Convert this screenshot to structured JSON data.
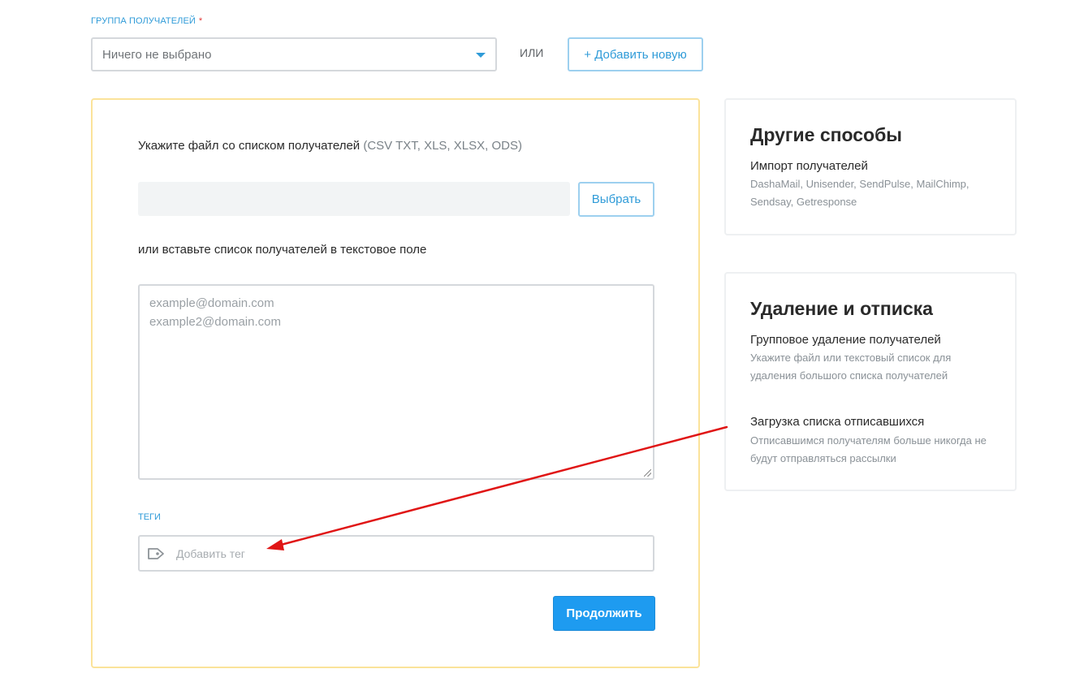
{
  "group": {
    "label": "ГРУППА ПОЛУЧАТЕЛЕЙ",
    "required_mark": "*",
    "select_value": "Ничего не выбрано",
    "or_text": "ИЛИ",
    "add_new_label": "+ Добавить новую"
  },
  "upload": {
    "file_hint": "Укажите файл со списком получателей",
    "file_formats": "(CSV TXT, XLS, XLSX, ODS)",
    "choose_button": "Выбрать",
    "paste_hint": "или вставьте список получателей в текстовое поле",
    "textarea_placeholder": "example@domain.com\nexample2@domain.com",
    "tags_label": "ТЕГИ",
    "tag_placeholder": "Добавить тег",
    "continue_button": "Продолжить"
  },
  "other_methods": {
    "title": "Другие способы",
    "import_title": "Импорт получателей",
    "import_desc": "DashaMail, Unisender, SendPulse, MailChimp, Sendsay, Getresponse"
  },
  "removal": {
    "title": "Удаление и отписка",
    "group_delete_title": "Групповое удаление получателей",
    "group_delete_desc": "Укажите файл или текстовый список для удаления большого списка получателей",
    "unsub_title": "Загрузка списка отписавшихся",
    "unsub_desc": "Отписавшимся получателям больше никогда не будут отправляться рассылки"
  },
  "colors": {
    "accent": "#2f9bd8",
    "primary_button": "#1e9bf0",
    "card_border_highlight": "#fbe39a",
    "annotation_arrow": "#e01515"
  },
  "icons": {
    "select_caret": "chevron-down-icon",
    "tag": "tag-icon"
  }
}
